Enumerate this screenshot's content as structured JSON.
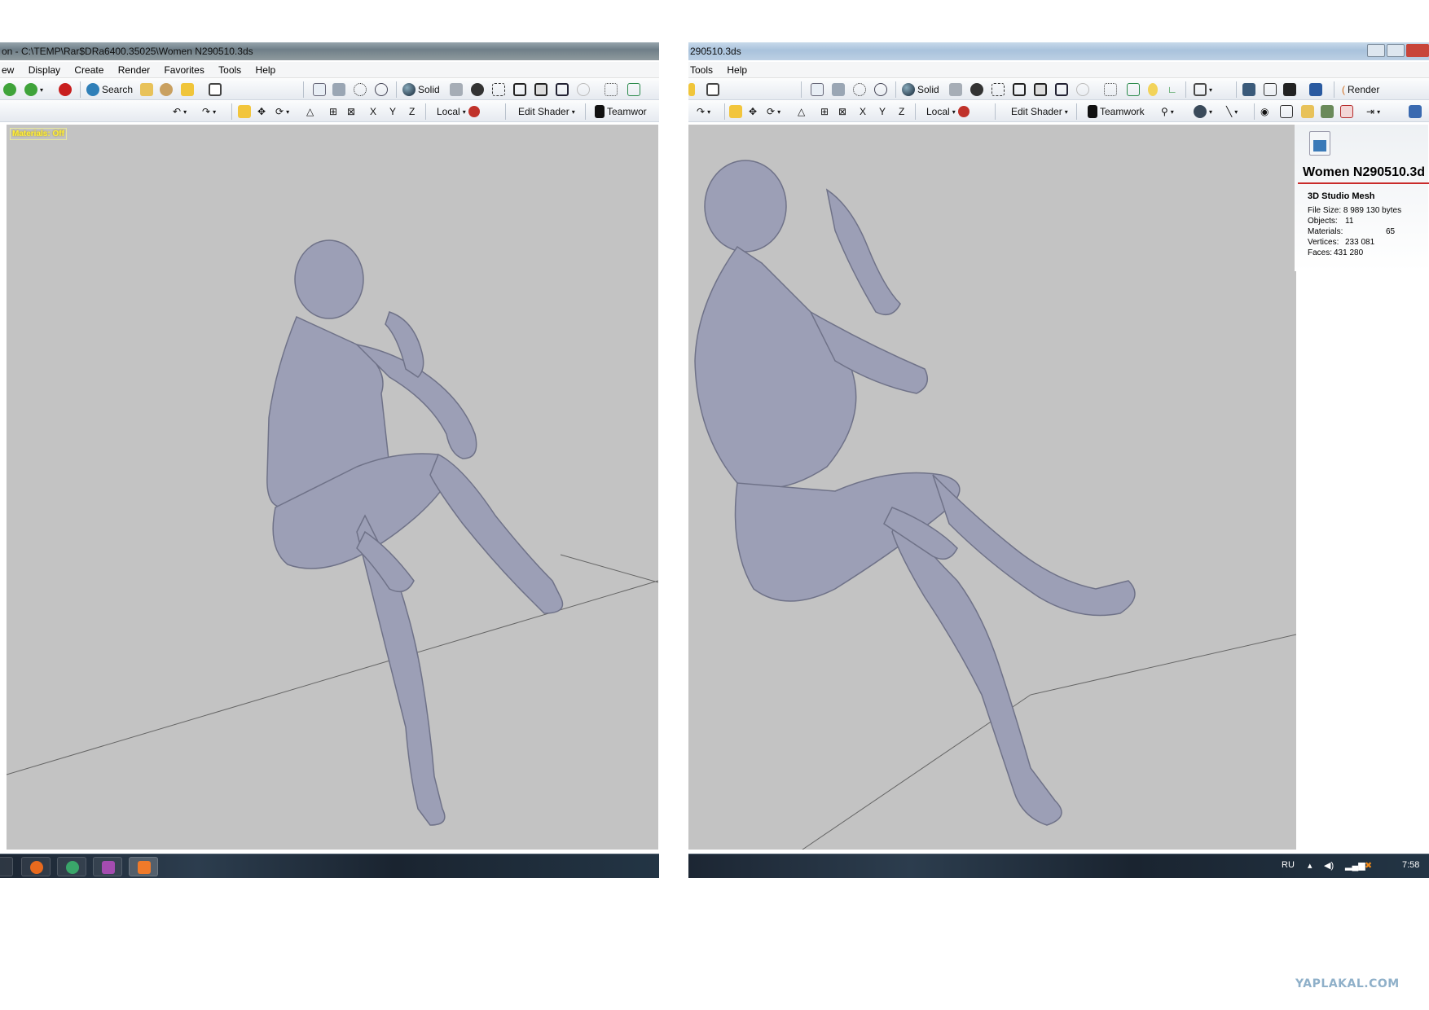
{
  "left": {
    "title": "on - C:\\TEMP\\Rar$DRa6400.35025\\Women N290510.3ds",
    "menu": [
      "ew",
      "Display",
      "Create",
      "Render",
      "Favorites",
      "Tools",
      "Help"
    ],
    "search_label": "Search",
    "solid_label": "Solid",
    "local_label": "Local",
    "edit_shader_label": "Edit Shader",
    "teamwork_label": "Teamwor",
    "axes": [
      "X",
      "Y",
      "Z"
    ],
    "materials_badge": "Materials: Off"
  },
  "right": {
    "title": "290510.3ds",
    "menu": [
      "Tools",
      "Help"
    ],
    "solid_label": "Solid",
    "local_label": "Local",
    "edit_shader_label": "Edit Shader",
    "teamwork_label": "Teamwork",
    "render_label": "Render",
    "axes": [
      "X",
      "Y",
      "Z"
    ],
    "info": {
      "file_name": "Women N290510.3d",
      "file_type": "3D Studio Mesh",
      "file_size": "File Size: 8 989 130 bytes",
      "objects_label": "Objects:",
      "objects_value": "11",
      "materials_label": "Materials:",
      "materials_value": "65",
      "vertices_label": "Vertices:",
      "vertices_value": "233 081",
      "faces_label": "Faces:",
      "faces_value": "431 280"
    },
    "tray": {
      "language": "RU",
      "time": "7:58"
    }
  },
  "watermark": "YAPLAKAL.COM",
  "colors": {
    "viewport_bg": "#c3c3c3",
    "model": "#9c9fb6",
    "badge_yellow": "#ffef3a",
    "rule_red": "#c92a2a"
  }
}
